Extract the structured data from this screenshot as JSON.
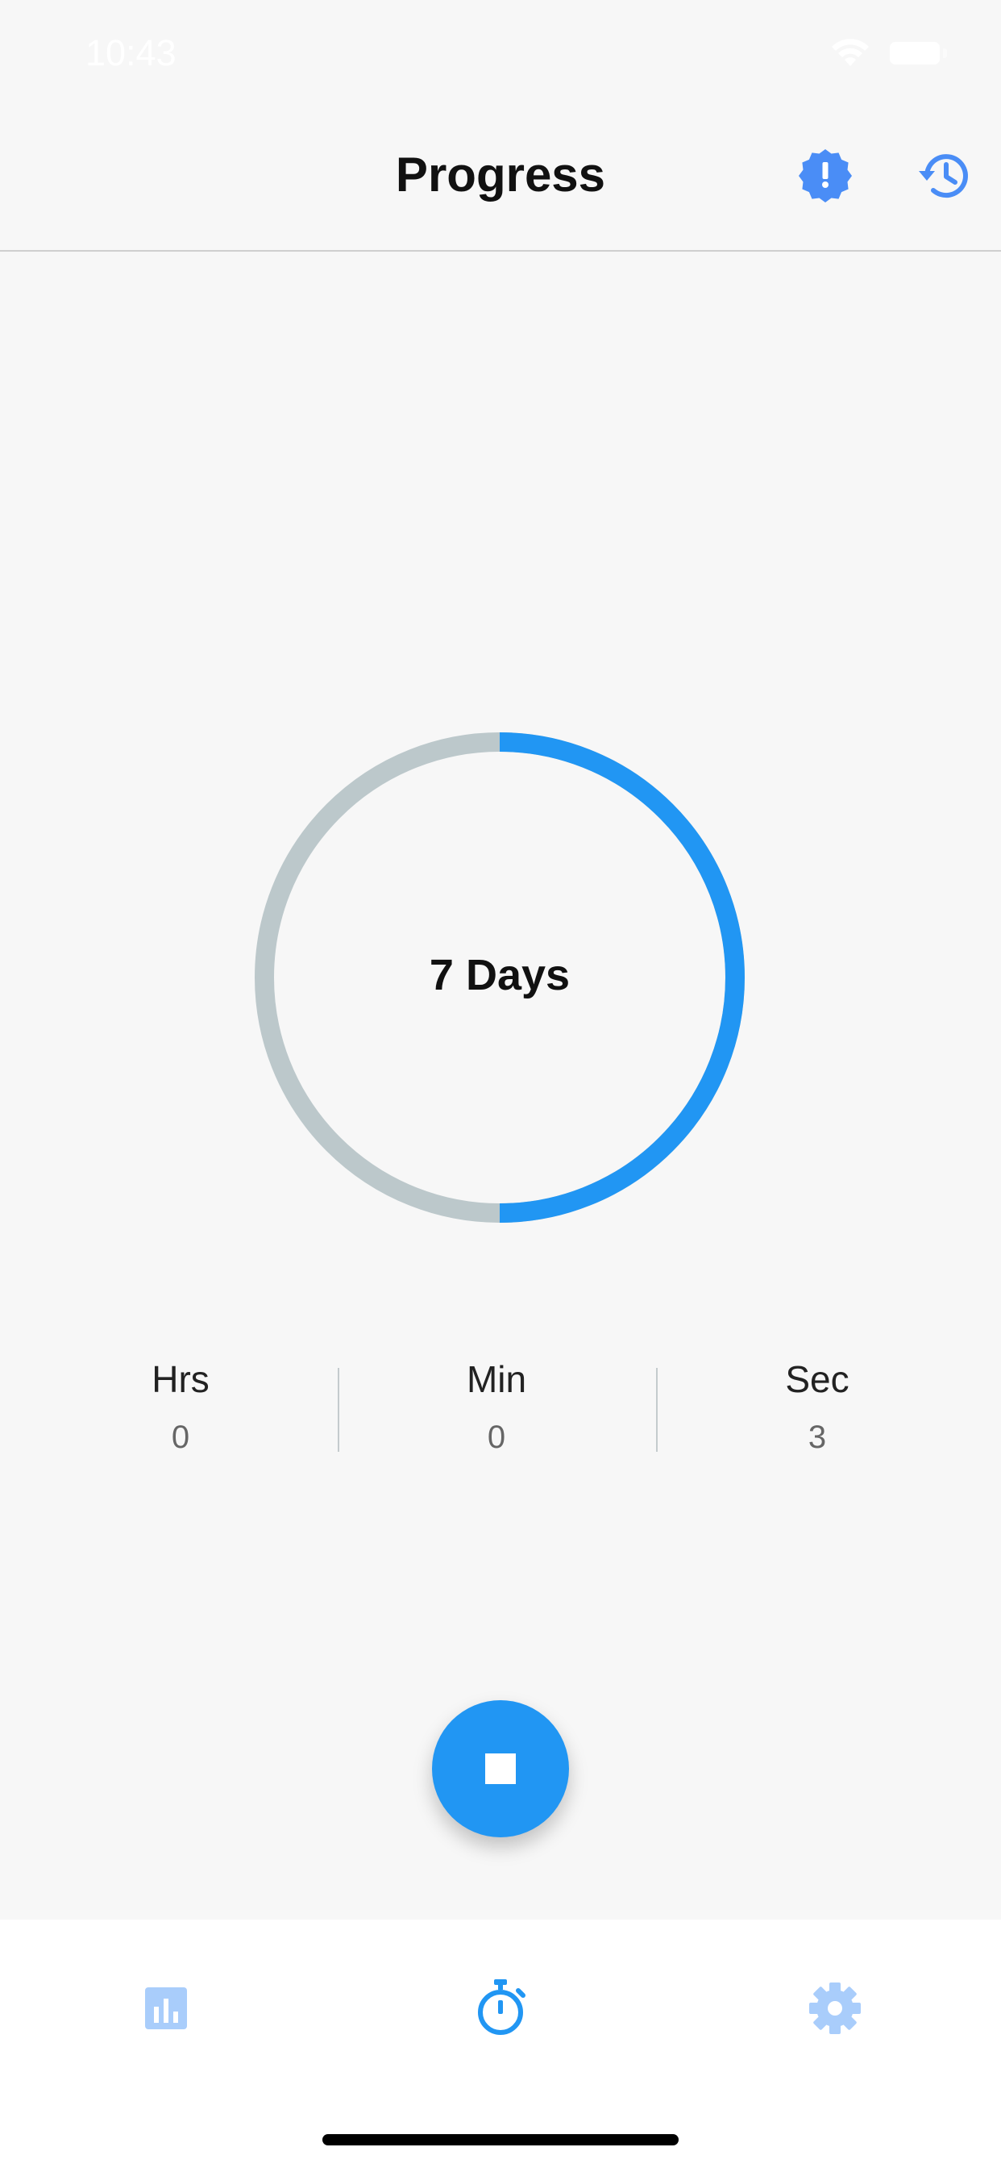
{
  "status_bar": {
    "time": "10:43",
    "wifi_icon": "wifi-icon",
    "battery_icon": "battery-icon"
  },
  "nav": {
    "title": "Progress",
    "alert_icon": "alert-badge-icon",
    "history_icon": "history-icon"
  },
  "progress": {
    "label": "7 Days",
    "fraction": 0.5,
    "track_color": "#bcc8cb",
    "fill_color": "#2196f3"
  },
  "stats": [
    {
      "label": "Hrs",
      "value": "0"
    },
    {
      "label": "Min",
      "value": "0"
    },
    {
      "label": "Sec",
      "value": "3"
    }
  ],
  "stop_button": {
    "icon": "stop-icon",
    "color": "#2196f3"
  },
  "tabs": [
    {
      "name": "stats",
      "icon": "bar-chart-icon",
      "active": false
    },
    {
      "name": "timer",
      "icon": "stopwatch-icon",
      "active": true
    },
    {
      "name": "settings",
      "icon": "gear-icon",
      "active": false
    }
  ],
  "colors": {
    "accent": "#2196f3",
    "accent_light": "#a9cdfb",
    "background": "#f7f7f7"
  }
}
